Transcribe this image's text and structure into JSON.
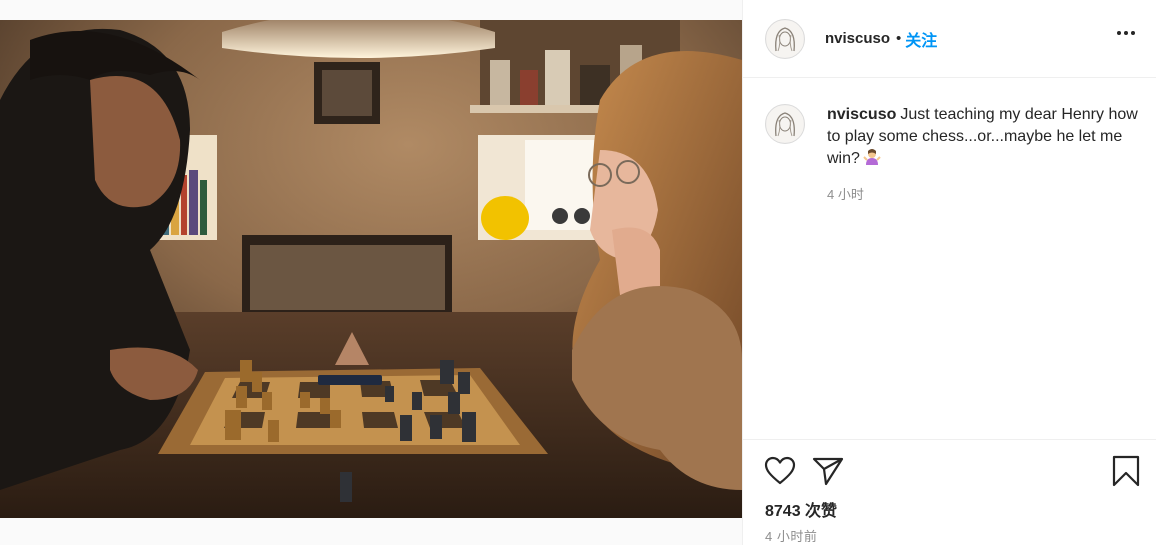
{
  "post": {
    "username": "nviscuso",
    "follow_separator": "•",
    "follow_label": "关注",
    "caption_username": "nviscuso",
    "caption_text": "Just teaching my dear Henry how to play some chess...or...maybe he let me win?",
    "caption_emoji": "woman-shrugging-emoji",
    "comment_time": "4 小时",
    "likes": "8743 次赞",
    "post_time": "4 小时前"
  },
  "icons": {
    "more": "more-options-icon",
    "like": "heart-icon",
    "share": "paper-plane-icon",
    "save": "bookmark-icon"
  },
  "colors": {
    "follow_blue": "#0095f6",
    "text": "#262626",
    "muted": "#8e8e8e",
    "divider": "#efefef"
  }
}
